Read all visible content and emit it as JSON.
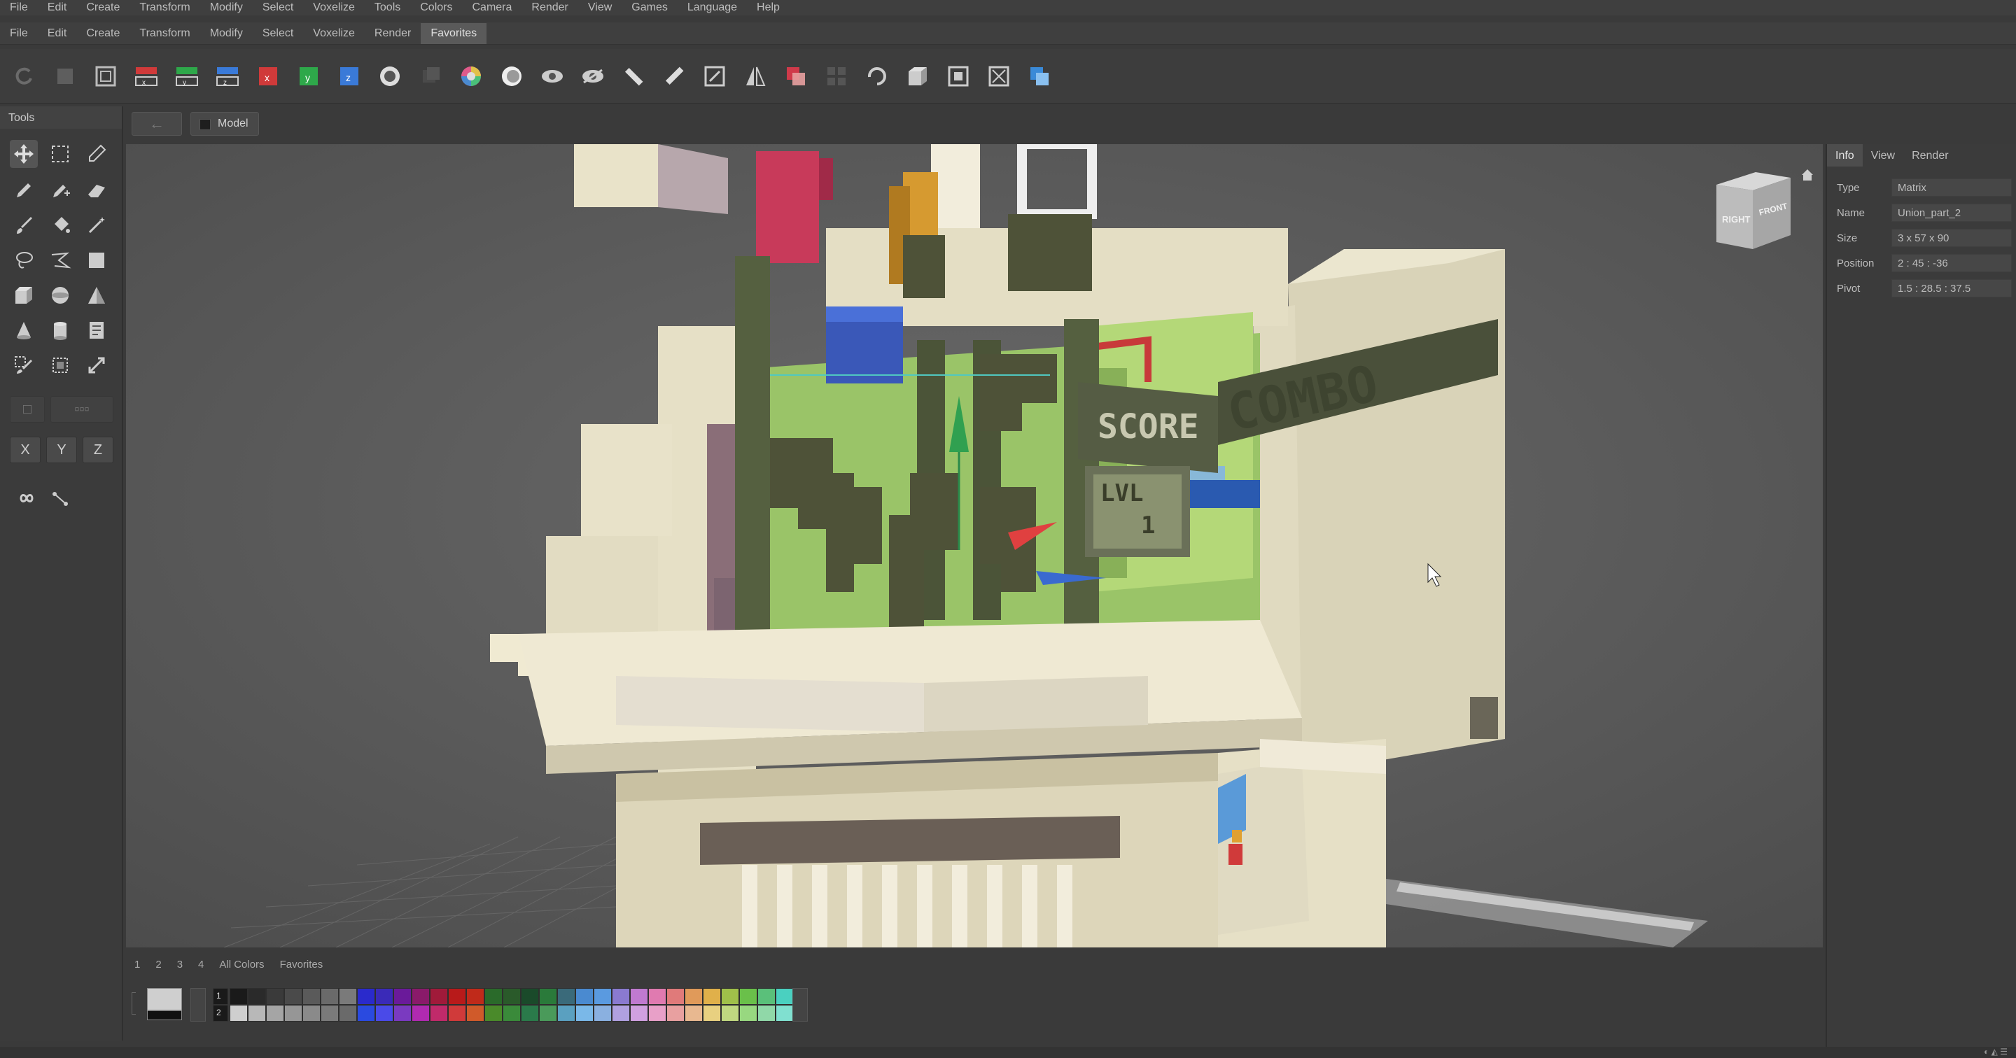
{
  "menubar_top": [
    "File",
    "Edit",
    "Create",
    "Transform",
    "Modify",
    "Select",
    "Voxelize",
    "Tools",
    "Colors",
    "Camera",
    "Render",
    "View",
    "Games",
    "Language",
    "Help"
  ],
  "menubar_second": [
    "File",
    "Edit",
    "Create",
    "Transform",
    "Modify",
    "Select",
    "Voxelize",
    "Render"
  ],
  "menubar_active": "Favorites",
  "tools_panel": {
    "title": "Tools",
    "axis": [
      "X",
      "Y",
      "Z"
    ]
  },
  "breadcrumb": {
    "back": "←",
    "model": "Model"
  },
  "viewcube": {
    "right": "RIGHT",
    "front": "FRONT"
  },
  "scene_text": {
    "score": "SCORE",
    "combo": "COMBO",
    "lvl": "LVL",
    "lvl_num": "1"
  },
  "info_panel": {
    "tabs": [
      "Info",
      "View",
      "Render"
    ],
    "rows": [
      {
        "label": "Type",
        "value": "Matrix"
      },
      {
        "label": "Name",
        "value": "Union_part_2"
      },
      {
        "label": "Size",
        "value": "3 x 57 x 90"
      },
      {
        "label": "Position",
        "value": "2 : 45 : -36"
      },
      {
        "label": "Pivot",
        "value": "1.5 : 28.5 : 37.5"
      }
    ]
  },
  "palette": {
    "tabs": [
      "1",
      "2",
      "3",
      "4",
      "All Colors",
      "Favorites"
    ],
    "row_labels": [
      "1",
      "2"
    ],
    "row1": [
      "#1a1a1a",
      "#2a2a2a",
      "#3a3a3a",
      "#4a4a4a",
      "#5a5a5a",
      "#6a6a6a",
      "#7a7a7a",
      "#2a2acc",
      "#3a2ab8",
      "#6a1a9a",
      "#8a1a6a",
      "#a01a3a",
      "#b81a1a",
      "#c02a1a",
      "#2a6a2a",
      "#2a5a2a",
      "#1a4a2a",
      "#2a7a3a",
      "#3a6a7a",
      "#4a8ad0",
      "#5a9ae0",
      "#8a7ad0",
      "#c07ad0",
      "#e07ab0",
      "#e07a7a",
      "#e09a5a",
      "#e0b04a",
      "#a0c04a",
      "#6ac04a",
      "#5ac07a",
      "#4ad0c0"
    ],
    "row2": [
      "#cfcfcf",
      "#b8b8b8",
      "#a5a5a5",
      "#969696",
      "#8a8a8a",
      "#7a7a7a",
      "#6a6a6a",
      "#2a4ae0",
      "#4a4ae8",
      "#7a3ac0",
      "#b02ab0",
      "#c02a6a",
      "#d03a3a",
      "#d05a2a",
      "#4a8a2a",
      "#3a8a3a",
      "#2a7a4a",
      "#4a9a5a",
      "#5aa0c0",
      "#7ab8e8",
      "#8ab0e0",
      "#b0a0e0",
      "#d0a0e0",
      "#e8a0c8",
      "#e8a0a0",
      "#e8b890",
      "#e8d080",
      "#c0d880",
      "#98d880",
      "#90d8a8",
      "#80e0d0"
    ]
  }
}
